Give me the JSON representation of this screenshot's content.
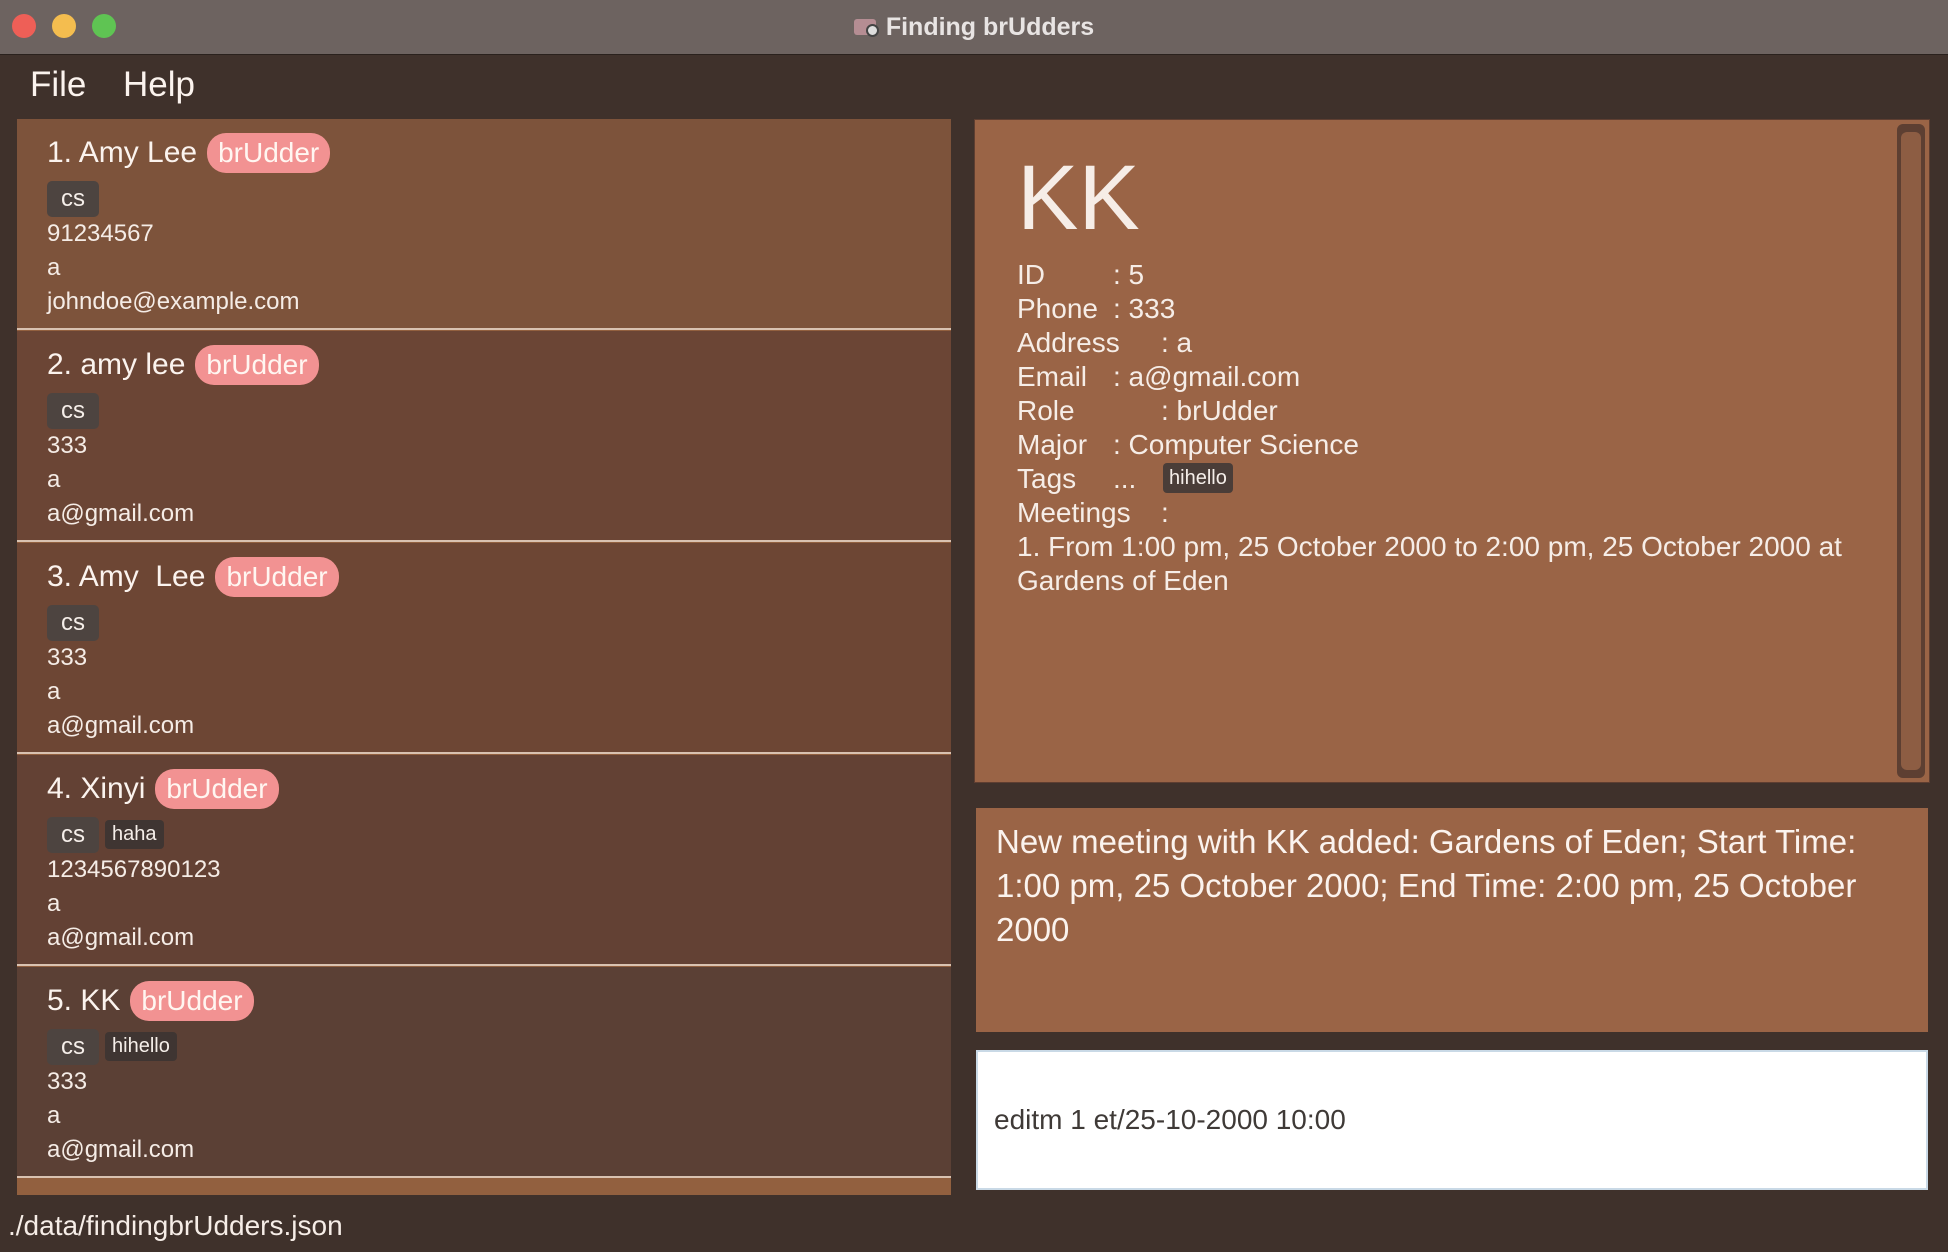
{
  "window": {
    "title": "Finding brUdders"
  },
  "menu": {
    "file": "File",
    "help": "Help"
  },
  "persons": [
    {
      "name": "1. Amy Lee",
      "role": "brUdder",
      "major": "cs",
      "tags": [],
      "phone": "91234567",
      "address": "a",
      "email": "johndoe@example.com"
    },
    {
      "name": "2. amy lee",
      "role": "brUdder",
      "major": "cs",
      "tags": [],
      "phone": "333",
      "address": "a",
      "email": "a@gmail.com"
    },
    {
      "name": "3. Amy  Lee",
      "role": "brUdder",
      "major": "cs",
      "tags": [],
      "phone": "333",
      "address": "a",
      "email": "a@gmail.com"
    },
    {
      "name": "4. Xinyi",
      "role": "brUdder",
      "major": "cs",
      "tags": [
        "haha"
      ],
      "phone": "1234567890123",
      "address": "a",
      "email": "a@gmail.com"
    },
    {
      "name": "5. KK",
      "role": "brUdder",
      "major": "cs",
      "tags": [
        "hihello"
      ],
      "phone": "333",
      "address": "a",
      "email": "a@gmail.com"
    }
  ],
  "detail": {
    "name": "KK",
    "id_label": "ID",
    "id_value": ": 5",
    "phone_label": "Phone",
    "phone_value": ": 333",
    "address_label": "Address",
    "address_value": ": a",
    "email_label": "Email",
    "email_value": ": a@gmail.com",
    "role_label": "Role",
    "role_value": ": brUdder",
    "major_label": "Major",
    "major_value": ": Computer Science",
    "tags_label": "Tags",
    "tags_sep": "...",
    "tags": [
      "hihello"
    ],
    "meetings_label": "Meetings",
    "meetings_sep": ":",
    "meetings": [
      "1. From 1:00 pm, 25 October 2000 to 2:00 pm, 25 October 2000 at Gardens of Eden"
    ]
  },
  "result": {
    "text": "New meeting with KK added: Gardens of Eden; Start Time: 1:00 pm, 25 October 2000; End Time: 2:00 pm, 25 October 2000"
  },
  "command": {
    "value": "editm 1 et/25-10-2000 10:00"
  },
  "status": {
    "path": "./data/findingbrUdders.json"
  }
}
